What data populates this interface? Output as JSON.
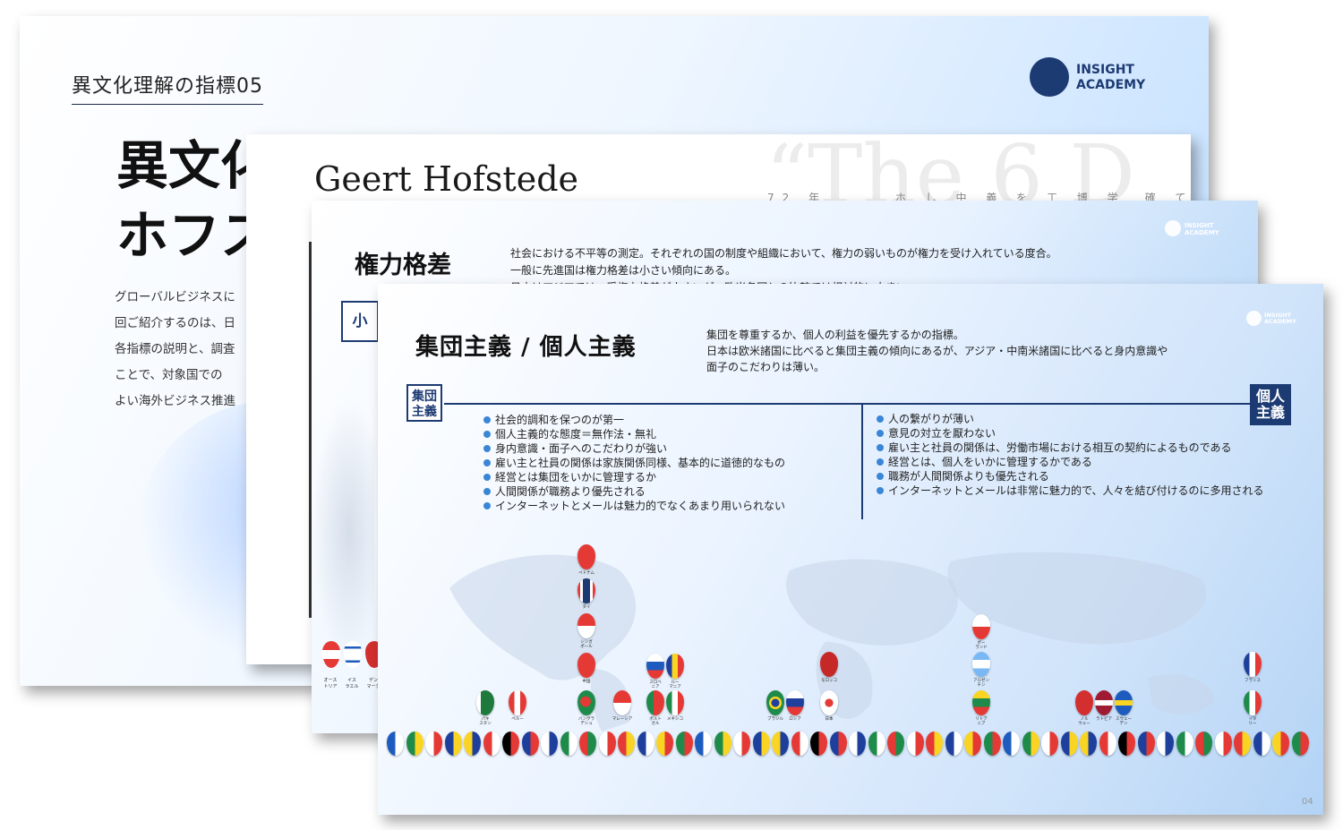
{
  "slide1": {
    "tag": "異文化理解の指標05",
    "logo_line1": "INSIGHT",
    "logo_line2": "ACADEMY",
    "title_line1": "異文化",
    "title_line2": "ホフス",
    "para": [
      "グローバルビジネスに",
      "回ご紹介するのは、日",
      "各指標の説明と、調査",
      "ことで、対象国での",
      "よい海外ビジネス推進"
    ]
  },
  "slide2": {
    "name": "Geert Hofstede",
    "quote": "“The 6 D",
    "kanji": "72 年　　　 ホ し 中 義 を 工 博 学　確 て し 研"
  },
  "slide3": {
    "title": "権力格差",
    "desc": [
      "社会における不平等の測定。それぞれの国の制度や組織において、権力の弱いものが権力を受け入れている度合。",
      "一般に先進国は権力格差は小さい傾向にある。",
      "日本はアジアでは、受権力格差が小さいが、欧米各国との比較では相対的に大きい。"
    ],
    "small_box": "小",
    "logo_line1": "INSIGHT",
    "logo_line2": "ACADEMY",
    "pin_labels": [
      "オース\nトリア",
      "イス\nラエル",
      "デン\nマーク"
    ]
  },
  "slide4": {
    "title": "集団主義 / 個人主義",
    "desc": [
      "集団を尊重するか、個人の利益を優先するかの指標。",
      "日本は欧米諸国に比べると集団主義の傾向にあるが、アジア・中南米諸国に比べると身内意識や",
      "面子のこだわりは薄い。"
    ],
    "logo_line1": "INSIGHT",
    "logo_line2": "ACADEMY",
    "box_left": [
      "集団",
      "主義"
    ],
    "box_right": [
      "個人",
      "主義"
    ],
    "left_items": [
      "社会的調和を保つのが第一",
      "個人主義的な態度＝無作法・無礼",
      "身内意識・面子へのこだわりが強い",
      "雇い主と社員の関係は家族関係同様、基本的に道徳的なもの",
      "経営とは集団をいかに管理するか",
      "人間関係が職務より優先される",
      "インターネットとメールは魅力的でなくあまり用いられない"
    ],
    "right_items": [
      "人の繋がりが薄い",
      "意見の対立を厭わない",
      "雇い主と社員の関係は、労働市場における相互の契約によるものである",
      "経営とは、個人をいかに管理するかである",
      "職務が人間関係よりも優先される",
      "インターネットとメールは非常に魅力的で、人々を結び付けるのに多用される"
    ],
    "page_number": "04",
    "pin_labels": {
      "vietnam": "ベトナム",
      "thailand": "タイ",
      "singapore": "シンガ\nポール",
      "china": "中国",
      "bangladesh": "バングラ\nデシュ",
      "malaysia": "マレーシア",
      "slovenia": "スロベ\nニア",
      "romania": "ルー\nマニア",
      "portugal": "ポルト\nガル",
      "mexico": "メキシコ",
      "pakistan": "パキ\nスタン",
      "peru": "ペルー",
      "brazil": "ブラジル",
      "russia": "ロシア",
      "morocco": "モロッコ",
      "japan": "日本",
      "poland": "ポー\nランド",
      "argentina": "アルゼン\nチン",
      "lithuania": "リトア\nニア",
      "norway": "ノル\nウェー",
      "latvia": "ラトビア",
      "sweden": "スウェー\nデン",
      "france": "フランス",
      "italy": "イタ\nリー"
    }
  }
}
